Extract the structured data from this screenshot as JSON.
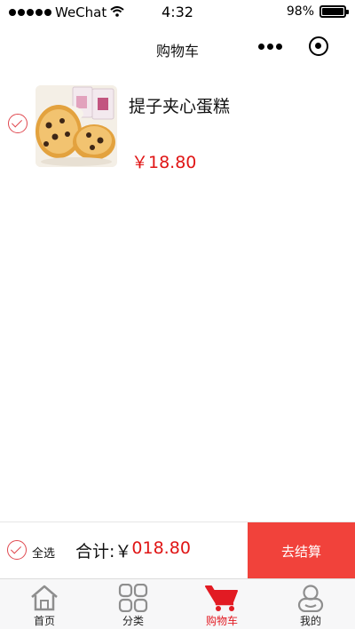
{
  "status_bar": {
    "carrier": "WeChat",
    "time": "4:32",
    "battery": "98%",
    "battery_level": 0.98
  },
  "nav": {
    "title": "购物车"
  },
  "cart": {
    "items": [
      {
        "name": "提子夹心蛋糕",
        "price": "￥18.80",
        "selected": true
      }
    ]
  },
  "footer": {
    "select_all_label": "全选",
    "total_label": "合计:",
    "currency": "￥",
    "total_value": "018.80",
    "checkout_label": "去结算"
  },
  "tabbar": {
    "tabs": [
      {
        "label": "首页",
        "icon": "home-icon",
        "active": false
      },
      {
        "label": "分类",
        "icon": "category-grid-icon",
        "active": false
      },
      {
        "label": "购物车",
        "icon": "cart-icon",
        "active": true
      },
      {
        "label": "我的",
        "icon": "user-icon",
        "active": false
      }
    ]
  },
  "colors": {
    "accent_red": "#e01515",
    "checkout_bg": "#f1423b",
    "check_ring": "#e0484f"
  }
}
